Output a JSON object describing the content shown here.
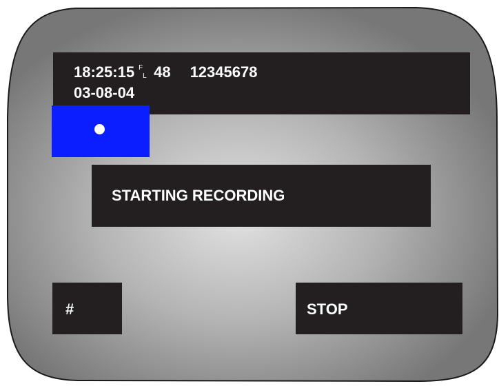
{
  "colors": {
    "bezel_edge": "#777777",
    "bezel_center": "#e2e2e2",
    "bar_background": "#231f20",
    "text": "#ffffff",
    "record_indicator": "#0a1eff"
  },
  "info_bar": {
    "time": "18:25:15",
    "field_top": "F",
    "field_bottom": "L",
    "channel": "48",
    "id_number": "12345678",
    "date": "03-08-04"
  },
  "record_indicator": {
    "icon": "record-dot-icon"
  },
  "message": {
    "text": "STARTING RECORDING"
  },
  "buttons": {
    "hash_label": "#",
    "stop_label": "STOP"
  }
}
